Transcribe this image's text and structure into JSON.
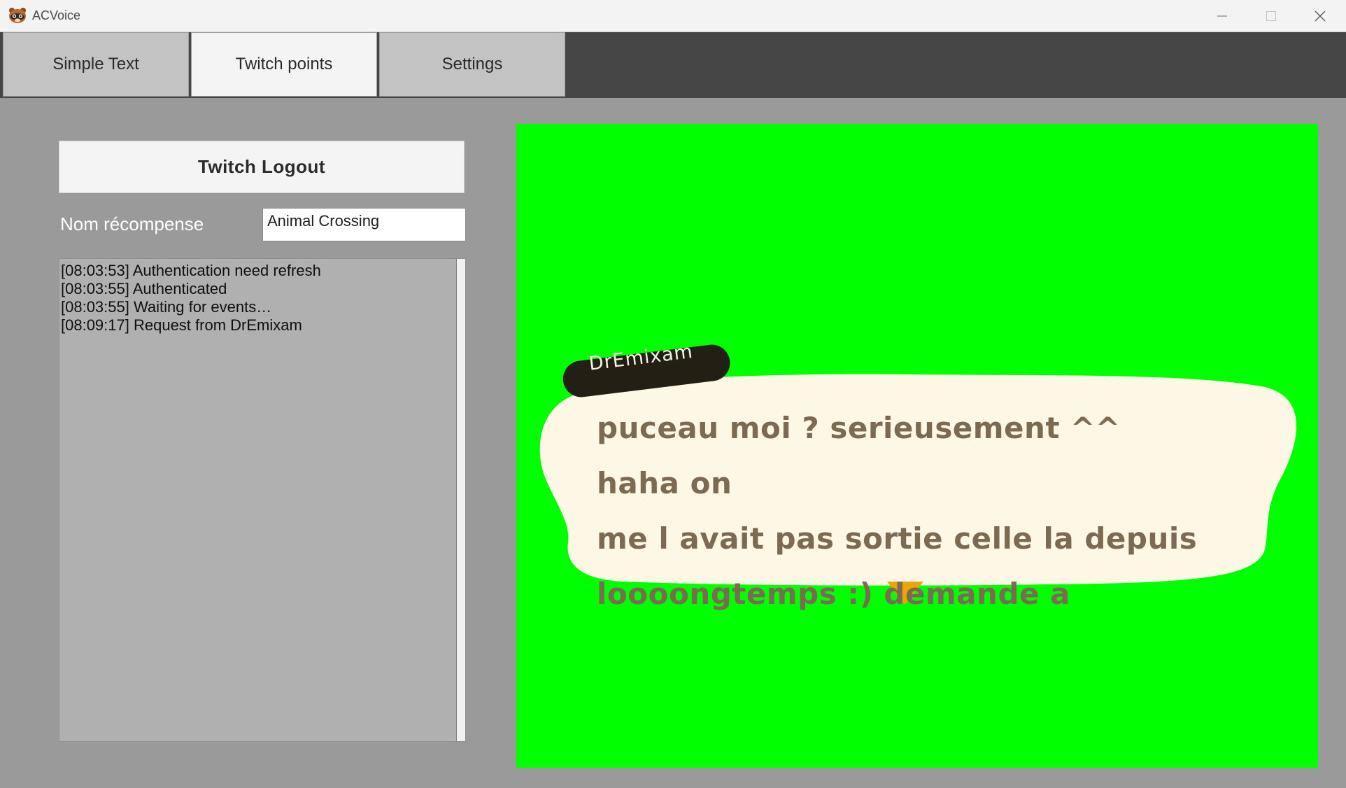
{
  "window": {
    "title": "ACVoice",
    "icon": "raccoon-app-icon",
    "controls": [
      "minimize-icon",
      "maximize-icon",
      "close-icon"
    ]
  },
  "tabs": [
    {
      "label": "Simple Text",
      "active": false
    },
    {
      "label": "Twitch points",
      "active": true
    },
    {
      "label": "Settings",
      "active": false
    }
  ],
  "panel": {
    "logout_label": "Twitch Logout",
    "reward_label": "Nom récompense",
    "reward_value": "Animal Crossing",
    "log": [
      "[08:03:53] Authentication need refresh",
      "[08:03:55] Authenticated",
      "[08:03:55] Waiting for events…",
      "[08:09:17] Request from DrEmixam"
    ]
  },
  "preview": {
    "background": "#00ff00",
    "speaker": "DrEmixam",
    "lines": [
      "puceau moi ? serieusement ^^ haha on",
      "me l avait pas sortie celle la depuis",
      "loooongtemps :) demande a"
    ],
    "bubble_color": "#fdf7e6",
    "text_color": "#7d6a52",
    "nametag_color": "#241f14",
    "arrow_color": "#e8a800"
  }
}
